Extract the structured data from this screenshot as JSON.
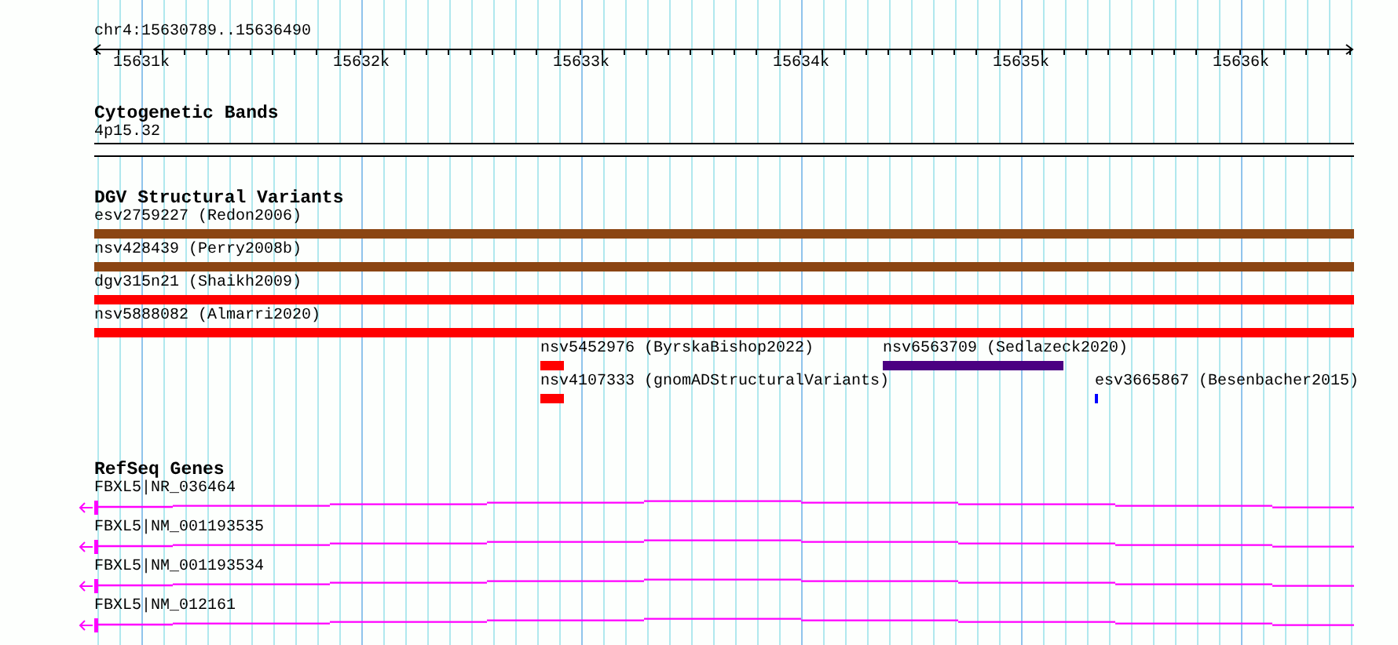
{
  "location": "chr4:15630789..15636490",
  "ruler": {
    "ticks": [
      "15631k",
      "15632k",
      "15633k",
      "15634k",
      "15635k",
      "15636k"
    ]
  },
  "tracks": [
    {
      "kind": "bands",
      "title": "Cytogenetic Bands",
      "features": [
        {
          "label": "4p15.32"
        }
      ]
    },
    {
      "kind": "variants",
      "title": "DGV Structural Variants",
      "features": [
        {
          "label": "esv2759227 (Redon2006)",
          "color": "#8b4513"
        },
        {
          "label": "nsv428439 (Perry2008b)",
          "color": "#8b4513"
        },
        {
          "label": "dgv315n21 (Shaikh2009)",
          "color": "#ff0000"
        },
        {
          "label": "nsv5888082 (Almarri2020)",
          "color": "#ff0000"
        },
        {
          "label": "nsv5452976 (ByrskaBishop2022)",
          "color": "#ff0000"
        },
        {
          "label": "nsv6563709 (Sedlazeck2020)",
          "color": "#4b0082"
        },
        {
          "label": "nsv4107333 (gnomADStructuralVariants)",
          "color": "#ff0000"
        },
        {
          "label": "esv3665867 (Besenbacher2015)",
          "color": "#0000ff"
        }
      ]
    },
    {
      "kind": "genes",
      "title": "RefSeq Genes",
      "features": [
        {
          "label": "FBXL5|NR_036464"
        },
        {
          "label": "FBXL5|NM_001193535"
        },
        {
          "label": "FBXL5|NM_001193534"
        },
        {
          "label": "FBXL5|NM_012161"
        }
      ]
    }
  ]
}
